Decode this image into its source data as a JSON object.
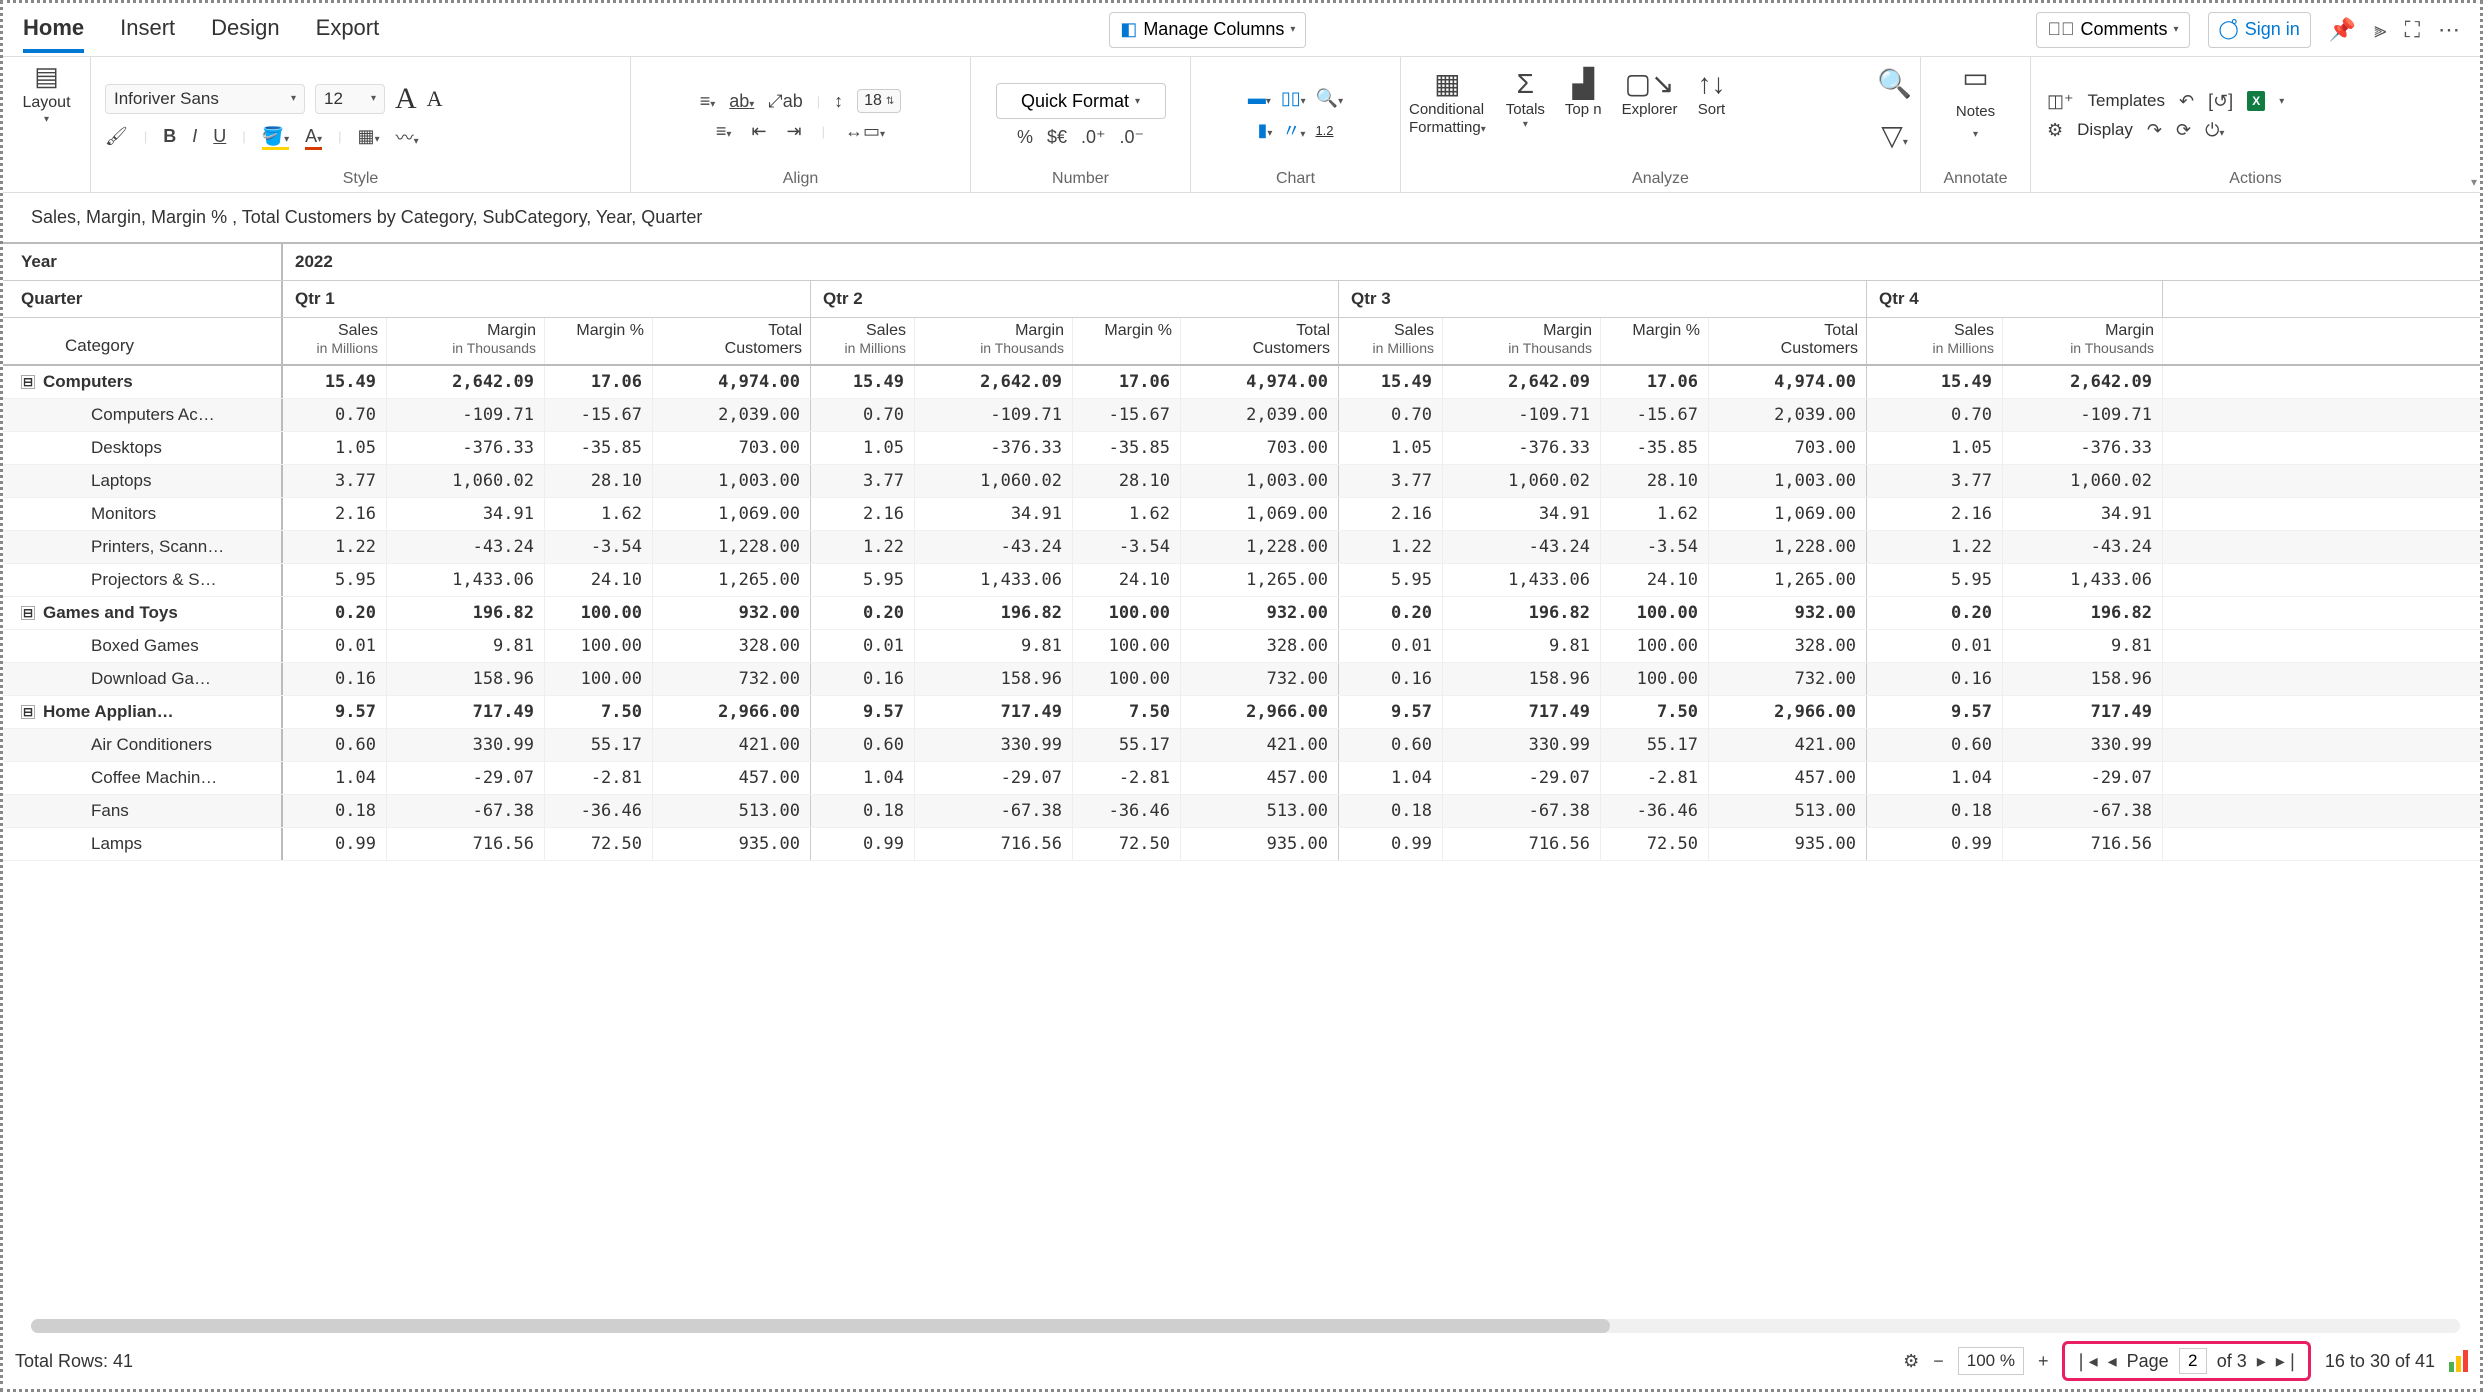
{
  "tabs": {
    "home": "Home",
    "insert": "Insert",
    "design": "Design",
    "export": "Export"
  },
  "topbar": {
    "manage_columns": "Manage Columns",
    "comments": "Comments",
    "sign_in": "Sign in"
  },
  "ribbon": {
    "layout": "Layout",
    "font_family": "Inforiver Sans",
    "font_size": "12",
    "row_h": "18",
    "quick_format": "Quick Format",
    "style_label": "Style",
    "align_label": "Align",
    "number_label": "Number",
    "chart_label": "Chart",
    "analyze_label": "Analyze",
    "annotate_label": "Annotate",
    "actions_label": "Actions",
    "scale": "1.2",
    "cond_fmt": "Conditional\nFormatting",
    "totals": "Totals",
    "topn": "Top n",
    "explorer": "Explorer",
    "sort": "Sort",
    "notes": "Notes",
    "templates": "Templates",
    "display": "Display"
  },
  "subtitle": "Sales, Margin, Margin % , Total Customers by Category, SubCategory, Year, Quarter",
  "grid": {
    "year_lbl": "Year",
    "year_val": "2022",
    "quarter_lbl": "Quarter",
    "quarters": [
      "Qtr 1",
      "Qtr 2",
      "Qtr 3",
      "Qtr 4"
    ],
    "cat_hdr": "Category",
    "cols": [
      {
        "t": "Sales",
        "s": "in Millions"
      },
      {
        "t": "Margin",
        "s": "in Thousands"
      },
      {
        "t": "Margin %",
        "s": ""
      },
      {
        "t": "Total\nCustomers",
        "s": ""
      }
    ],
    "q4cols": [
      {
        "t": "Sales",
        "s": "in Millions"
      },
      {
        "t": "Margin",
        "s": "in Thousands"
      }
    ],
    "rows": [
      {
        "bold": true,
        "exp": true,
        "label": "Computers",
        "v": [
          "15.49",
          "2,642.09",
          "17.06",
          "4,974.00"
        ]
      },
      {
        "sub": true,
        "label": "Computers Ac…",
        "v": [
          "0.70",
          "-109.71",
          "-15.67",
          "2,039.00"
        ]
      },
      {
        "sub": true,
        "label": "Desktops",
        "v": [
          "1.05",
          "-376.33",
          "-35.85",
          "703.00"
        ]
      },
      {
        "sub": true,
        "label": "Laptops",
        "v": [
          "3.77",
          "1,060.02",
          "28.10",
          "1,003.00"
        ]
      },
      {
        "sub": true,
        "label": "Monitors",
        "v": [
          "2.16",
          "34.91",
          "1.62",
          "1,069.00"
        ]
      },
      {
        "sub": true,
        "label": "Printers, Scann…",
        "v": [
          "1.22",
          "-43.24",
          "-3.54",
          "1,228.00"
        ]
      },
      {
        "sub": true,
        "label": "Projectors & S…",
        "v": [
          "5.95",
          "1,433.06",
          "24.10",
          "1,265.00"
        ]
      },
      {
        "bold": true,
        "exp": true,
        "label": "Games and Toys",
        "v": [
          "0.20",
          "196.82",
          "100.00",
          "932.00"
        ]
      },
      {
        "sub": true,
        "label": "Boxed Games",
        "v": [
          "0.01",
          "9.81",
          "100.00",
          "328.00"
        ]
      },
      {
        "sub": true,
        "label": "Download Ga…",
        "v": [
          "0.16",
          "158.96",
          "100.00",
          "732.00"
        ]
      },
      {
        "bold": true,
        "exp": true,
        "label": "Home Applian…",
        "v": [
          "9.57",
          "717.49",
          "7.50",
          "2,966.00"
        ]
      },
      {
        "sub": true,
        "label": "Air Conditioners",
        "v": [
          "0.60",
          "330.99",
          "55.17",
          "421.00"
        ]
      },
      {
        "sub": true,
        "label": "Coffee Machin…",
        "v": [
          "1.04",
          "-29.07",
          "-2.81",
          "457.00"
        ]
      },
      {
        "sub": true,
        "label": "Fans",
        "v": [
          "0.18",
          "-67.38",
          "-36.46",
          "513.00"
        ]
      },
      {
        "sub": true,
        "label": "Lamps",
        "v": [
          "0.99",
          "716.56",
          "72.50",
          "935.00"
        ]
      }
    ]
  },
  "footer": {
    "total_rows": "Total Rows: 41",
    "zoom": "100 %",
    "page_lbl": "Page",
    "page": "2",
    "of": "of 3",
    "range": "16 to 30 of 41"
  },
  "col_widths": {
    "sales": 104,
    "margin": 158,
    "mpct": 108,
    "cust": 158,
    "q4s": 136,
    "q4m": 160
  }
}
